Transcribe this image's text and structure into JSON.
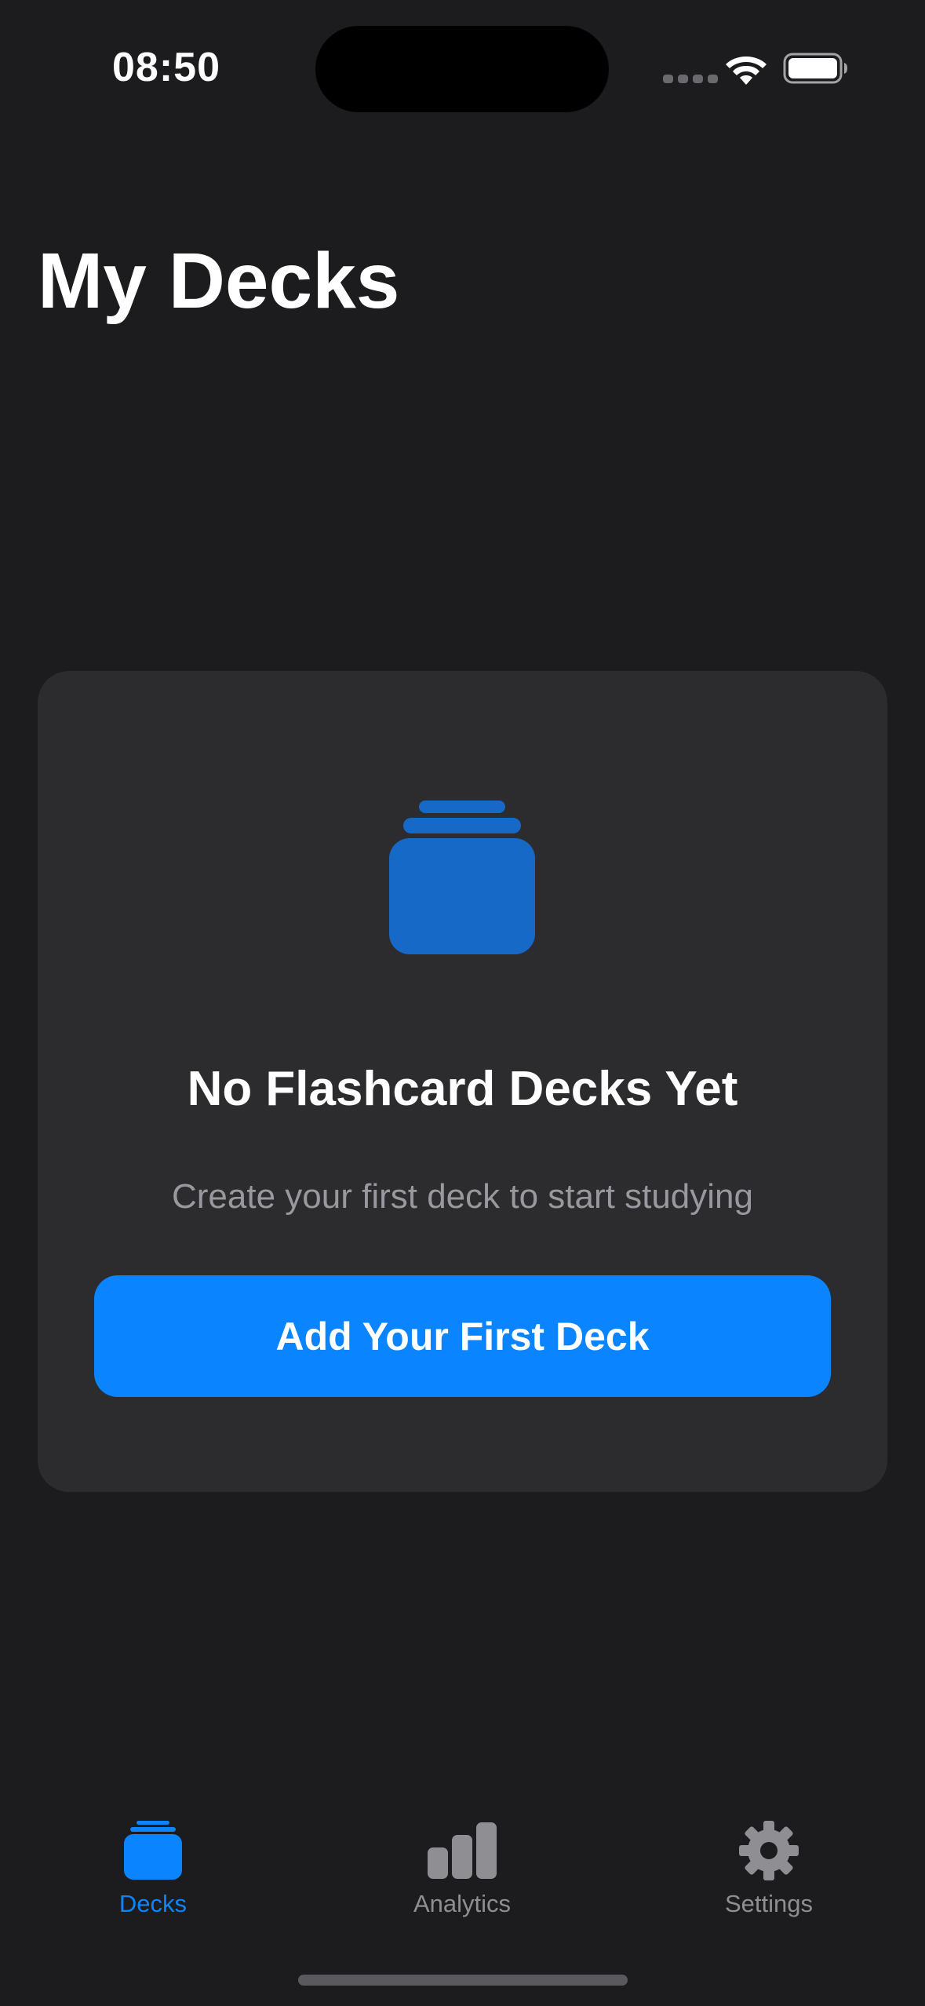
{
  "status_bar": {
    "time": "08:50",
    "icons": [
      "cellular-signal-icon",
      "wifi-icon",
      "battery-icon"
    ]
  },
  "page": {
    "title": "My Decks"
  },
  "empty_state": {
    "icon": "flashcard-stack-icon",
    "title": "No Flashcard Decks Yet",
    "subtitle": "Create your first deck to start studying",
    "button_label": "Add Your First Deck"
  },
  "tab_bar": {
    "items": [
      {
        "label": "Decks",
        "icon": "flashcard-stack-icon",
        "selected": true
      },
      {
        "label": "Analytics",
        "icon": "bar-chart-icon",
        "selected": false
      },
      {
        "label": "Settings",
        "icon": "gear-icon",
        "selected": false
      }
    ]
  },
  "colors": {
    "background": "#1c1c1e",
    "card": "#2c2c2e",
    "accent": "#0a84ff",
    "icon_blue": "#1769c7",
    "inactive": "#8e8e93",
    "secondary_text": "#98989e"
  }
}
